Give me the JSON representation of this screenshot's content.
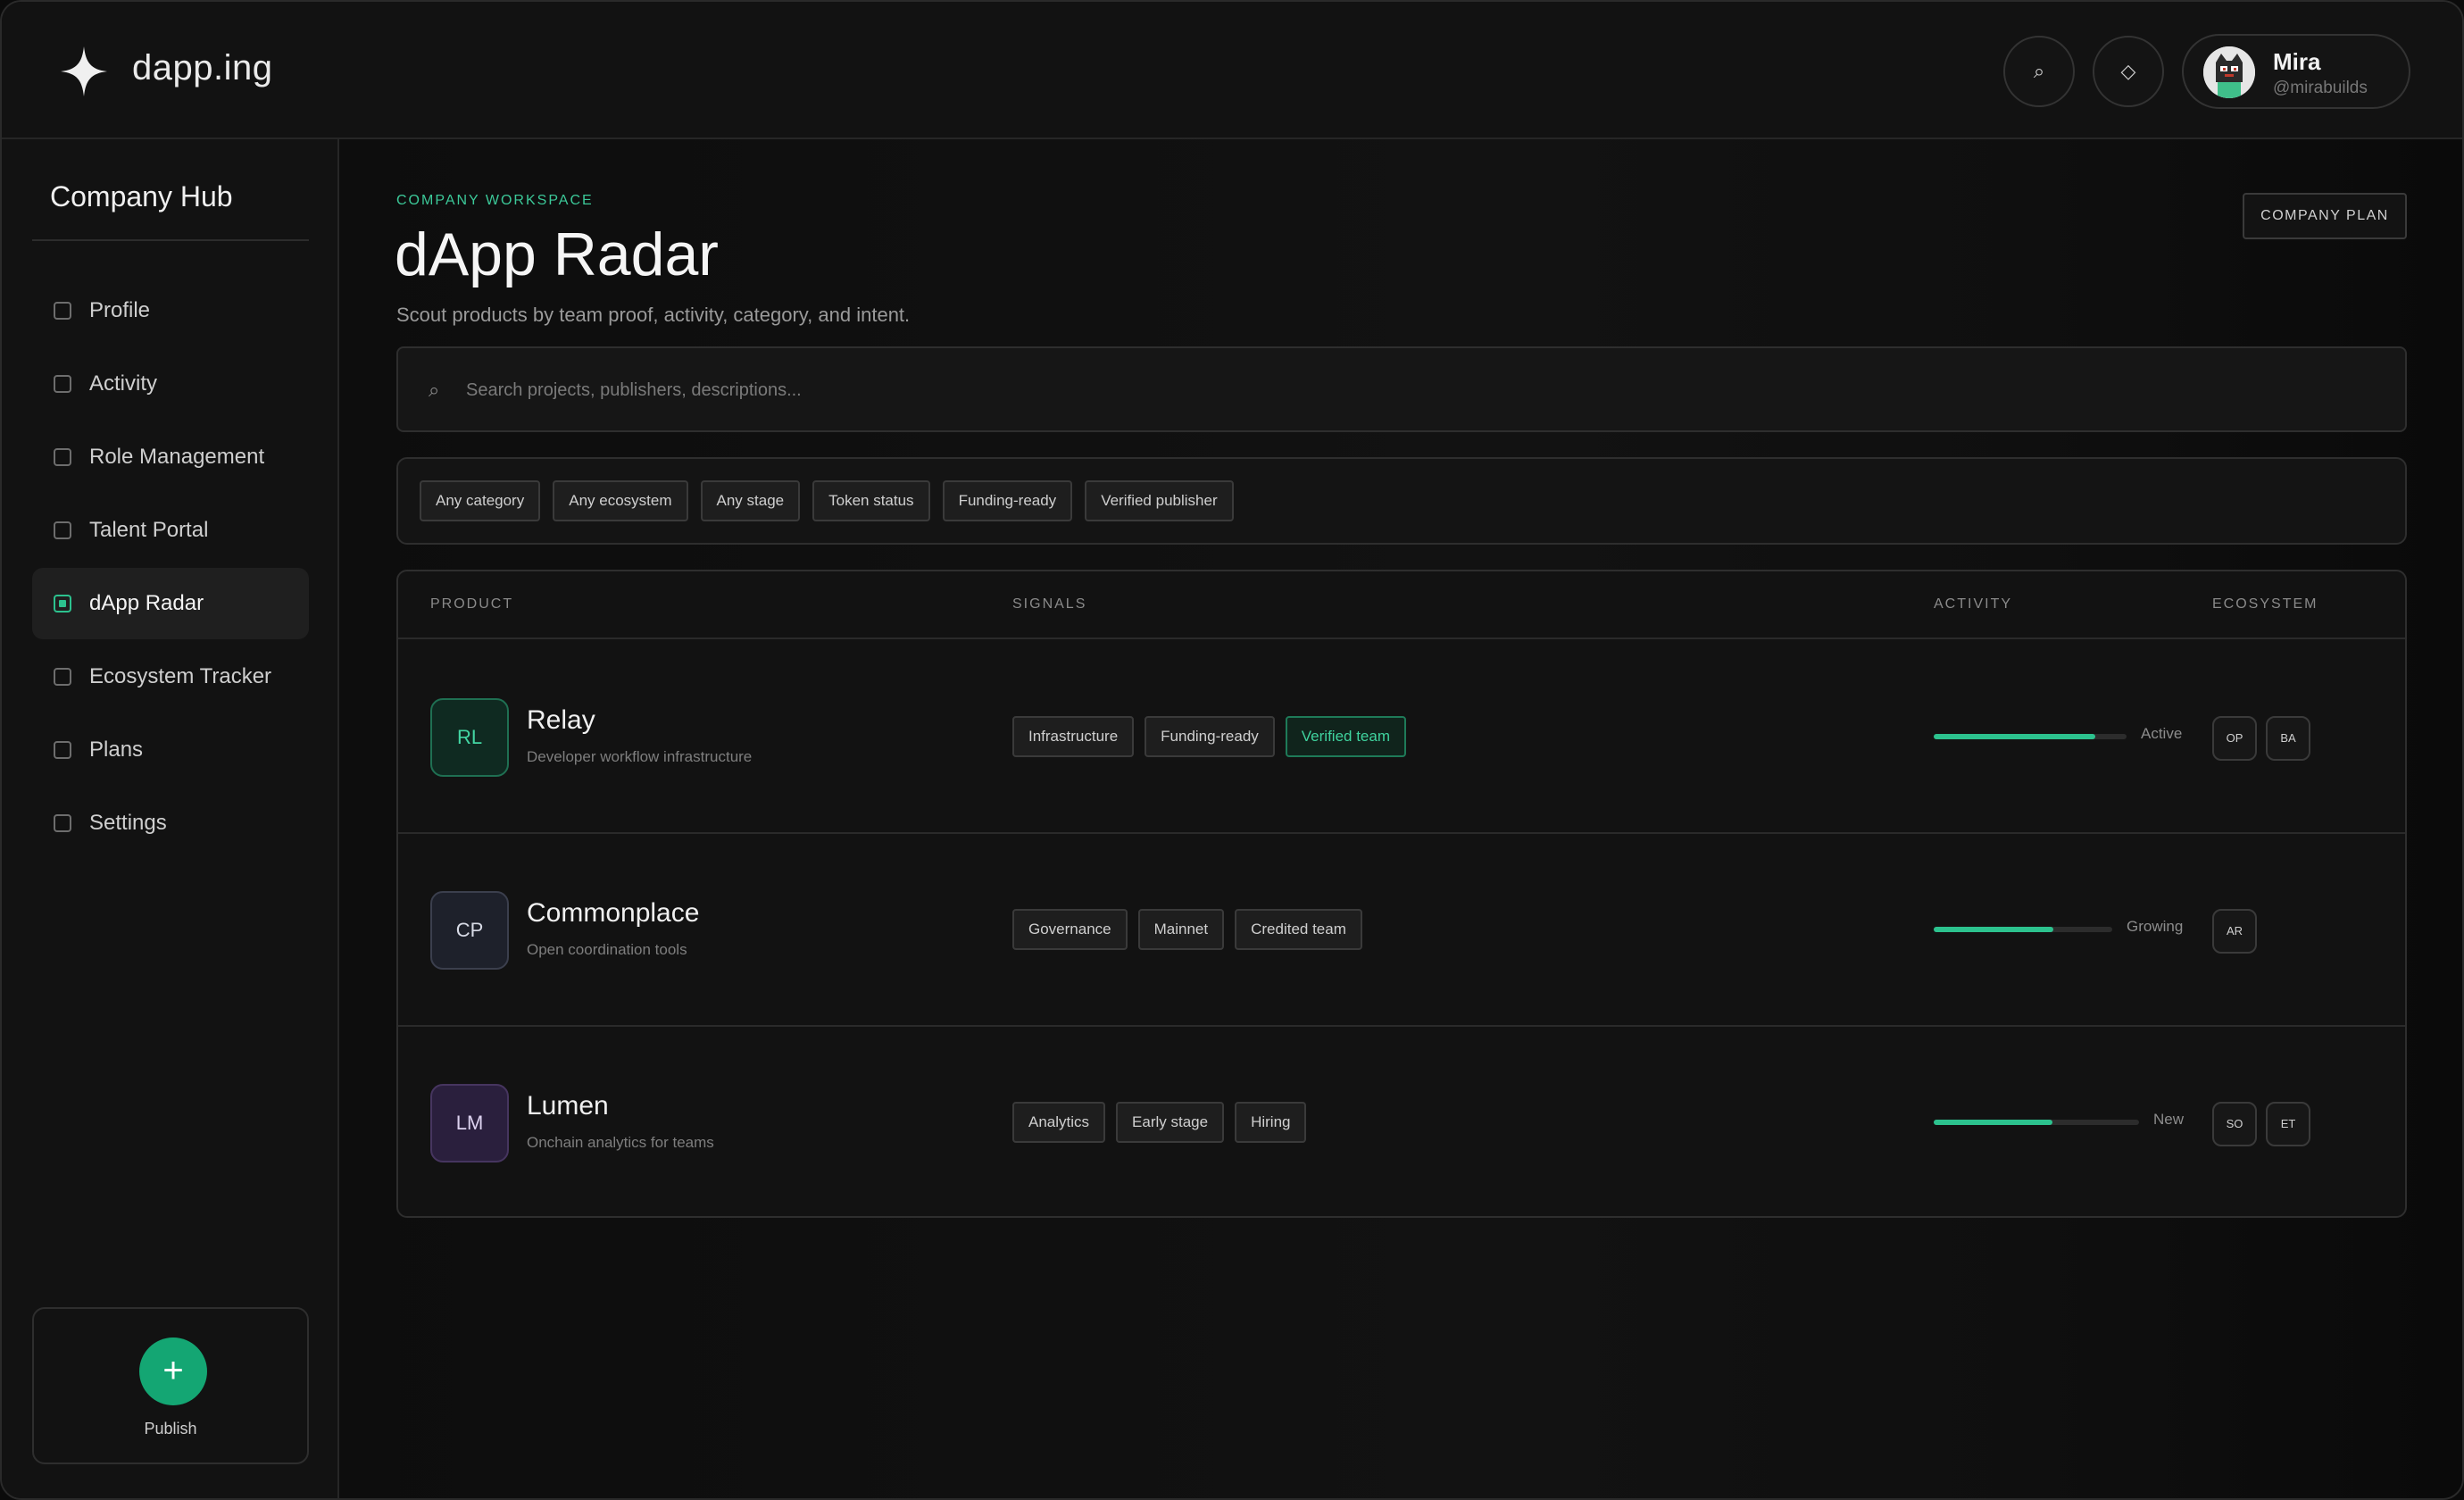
{
  "brand": {
    "name": "dapp.ing"
  },
  "header": {
    "search_icon": "search-icon",
    "diamond_icon": "diamond-icon",
    "search_glyph": "⌕",
    "diamond_glyph": "◇",
    "user": {
      "name": "Mira",
      "handle": "@mirabuilds"
    }
  },
  "sidebar": {
    "title": "Company Hub",
    "items": [
      {
        "label": "Profile",
        "active": false
      },
      {
        "label": "Activity",
        "active": false
      },
      {
        "label": "Role Management",
        "active": false
      },
      {
        "label": "Talent Portal",
        "active": false
      },
      {
        "label": "dApp Radar",
        "active": true
      },
      {
        "label": "Ecosystem Tracker",
        "active": false
      },
      {
        "label": "Plans",
        "active": false
      },
      {
        "label": "Settings",
        "active": false
      }
    ],
    "publish": {
      "icon": "+",
      "label": "Publish"
    }
  },
  "main": {
    "eyebrow": "COMPANY WORKSPACE",
    "title": "dApp Radar",
    "subtitle": "Scout products by team proof, activity, category, and intent.",
    "plan_button": "COMPANY PLAN",
    "search": {
      "icon": "⌕",
      "placeholder": "Search projects, publishers, descriptions..."
    },
    "filters": [
      "Any category",
      "Any ecosystem",
      "Any stage",
      "Token status",
      "Funding-ready",
      "Verified publisher"
    ],
    "table": {
      "headers": {
        "product": "PRODUCT",
        "signals": "SIGNALS",
        "activity": "ACTIVITY",
        "ecosystem": "ECOSYSTEM"
      },
      "rows": [
        {
          "initials": "RL",
          "name": "Relay",
          "desc": "Developer workflow infrastructure",
          "badge_bg": "#0f2a21",
          "badge_border": "#1f6f52",
          "badge_color": "#43d6a3",
          "signals": [
            {
              "label": "Infrastructure",
              "highlight": false
            },
            {
              "label": "Funding-ready",
              "highlight": false
            },
            {
              "label": "Verified team",
              "highlight": true
            }
          ],
          "activity": {
            "label": "Active",
            "level": 0.84
          },
          "ecosystem": [
            "OP",
            "BA"
          ]
        },
        {
          "initials": "CP",
          "name": "Commonplace",
          "desc": "Open coordination tools",
          "badge_bg": "#1e212b",
          "badge_border": "#3b3f4d",
          "badge_color": "#d8dbe6",
          "signals": [
            {
              "label": "Governance",
              "highlight": false
            },
            {
              "label": "Mainnet",
              "highlight": false
            },
            {
              "label": "Credited team",
              "highlight": false
            }
          ],
          "activity": {
            "label": "Growing",
            "level": 0.67
          },
          "ecosystem": [
            "AR"
          ]
        },
        {
          "initials": "LM",
          "name": "Lumen",
          "desc": "Onchain analytics for teams",
          "badge_bg": "#2a1f3d",
          "badge_border": "#46355f",
          "badge_color": "#ddd2f0",
          "signals": [
            {
              "label": "Analytics",
              "highlight": false
            },
            {
              "label": "Early stage",
              "highlight": false
            },
            {
              "label": "Hiring",
              "highlight": false
            }
          ],
          "activity": {
            "label": "New",
            "level": 0.58
          },
          "ecosystem": [
            "SO",
            "ET"
          ]
        }
      ]
    }
  },
  "colors": {
    "accent": "#2cc28e",
    "publish": "#14a673"
  }
}
